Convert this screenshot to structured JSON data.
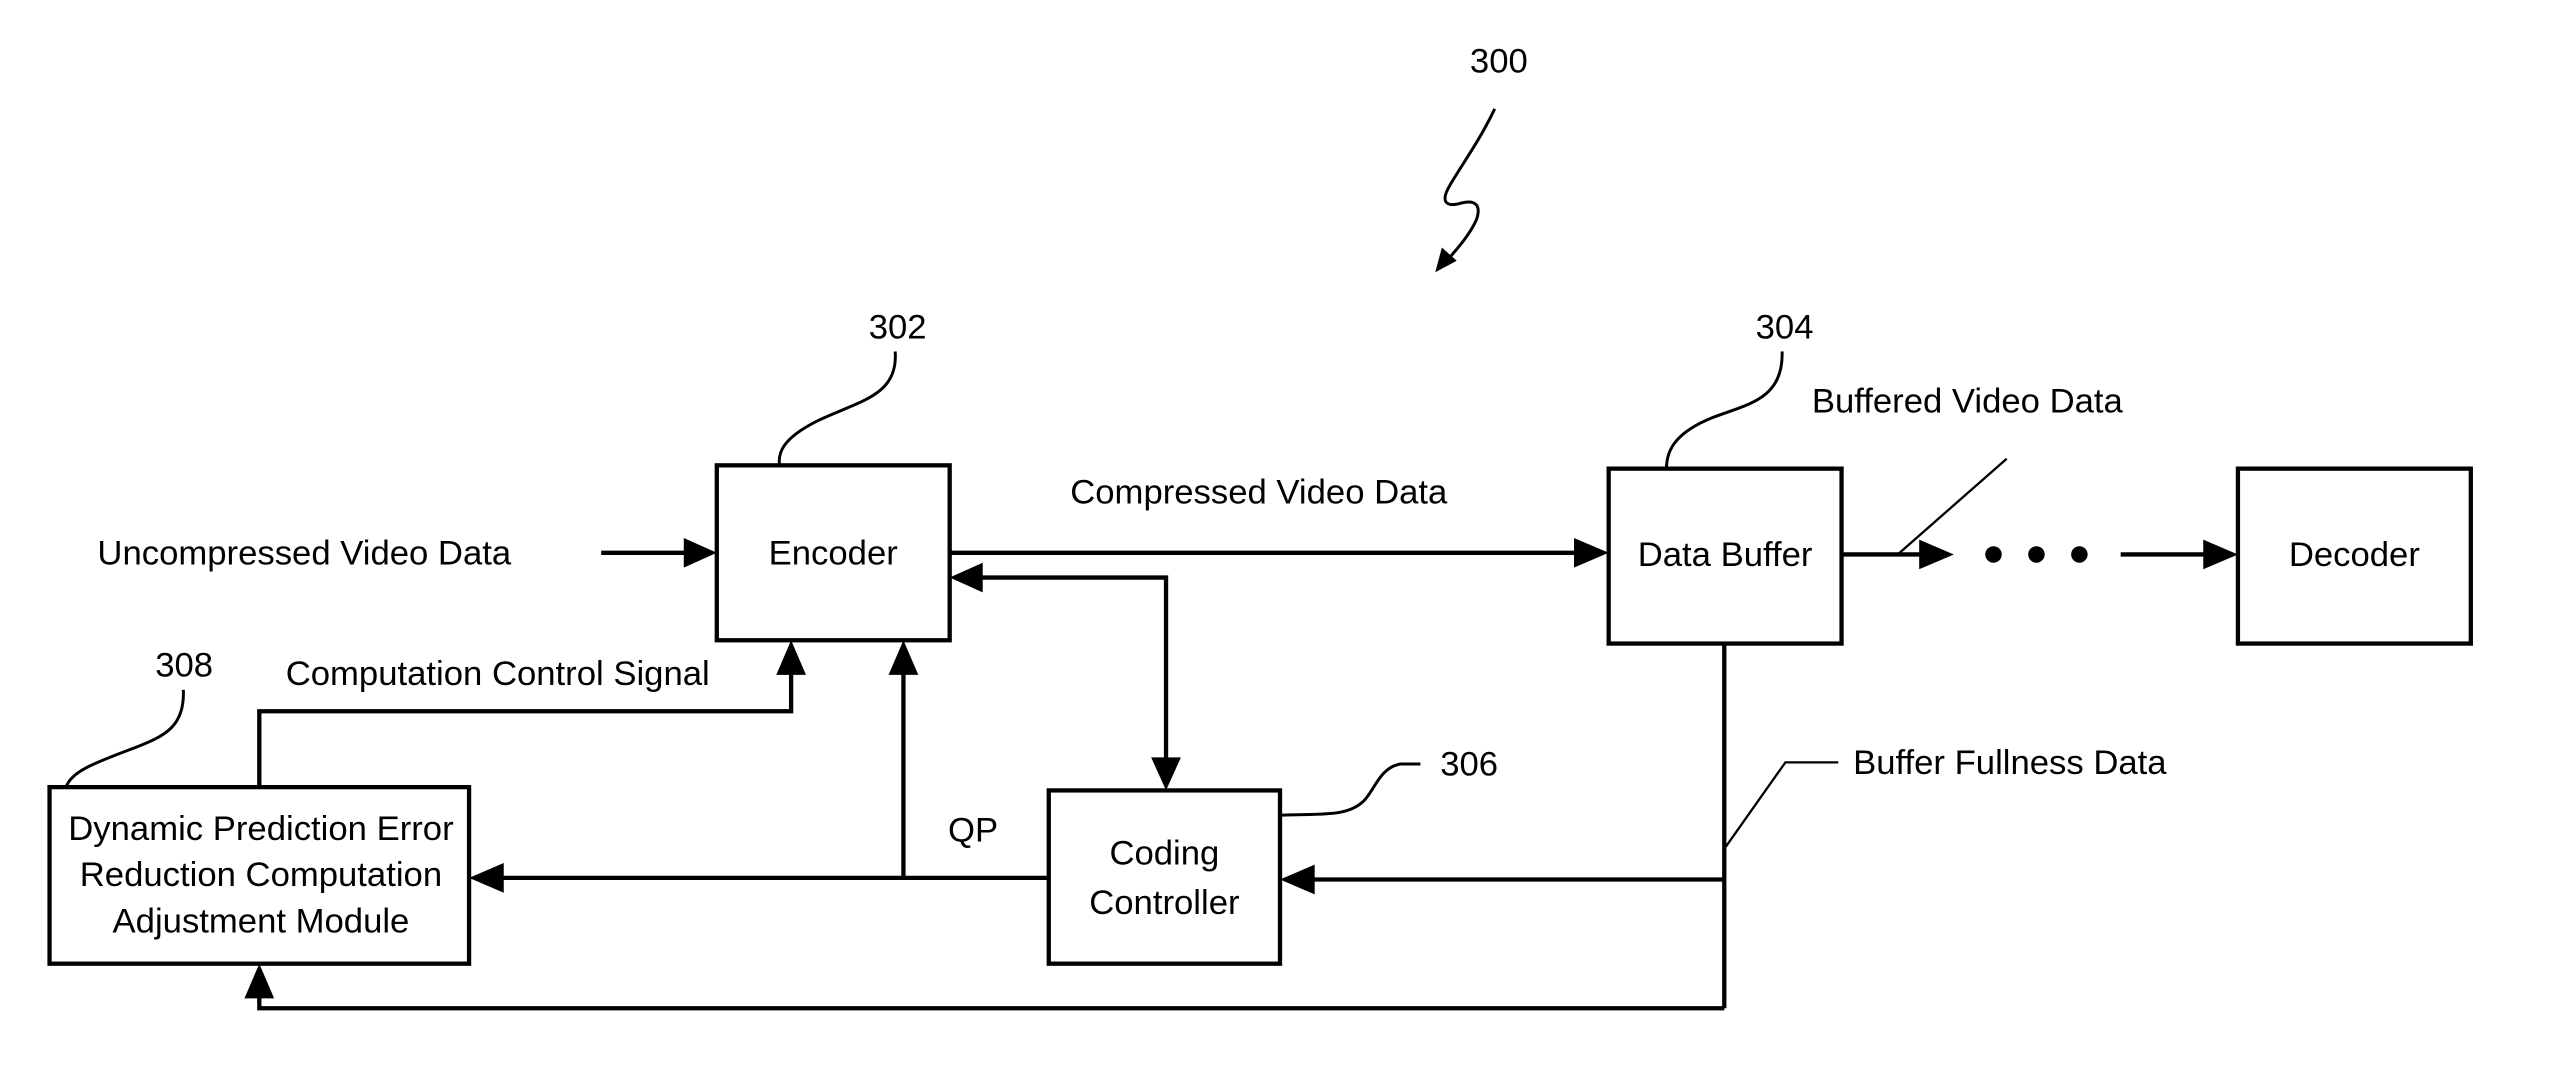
{
  "figure": {
    "ref": "300"
  },
  "blocks": {
    "encoder": {
      "label": "Encoder",
      "ref": "302"
    },
    "data_buffer": {
      "label": "Data Buffer",
      "ref": "304"
    },
    "decoder": {
      "label": "Decoder"
    },
    "coding_controller": {
      "lines": [
        "Coding",
        "Controller"
      ],
      "ref": "306"
    },
    "adjustment_module": {
      "lines": [
        "Dynamic Prediction Error",
        "Reduction Computation",
        "Adjustment Module"
      ],
      "ref": "308"
    }
  },
  "signals": {
    "uncompressed": "Uncompressed Video Data",
    "compressed": "Compressed Video Data",
    "buffered": "Buffered Video Data",
    "computation_control": "Computation Control Signal",
    "qp": "QP",
    "buffer_fullness": "Buffer Fullness Data",
    "ellipsis": "• • •"
  }
}
